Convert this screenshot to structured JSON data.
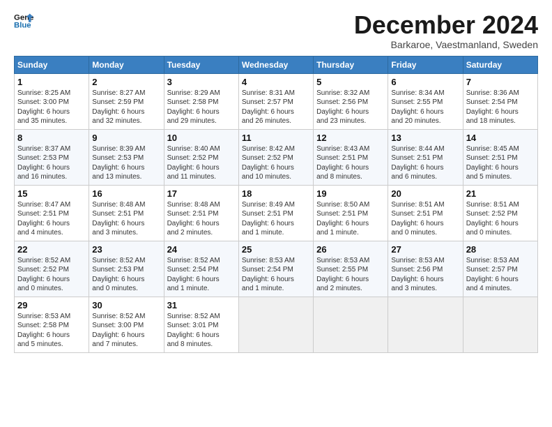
{
  "header": {
    "logo_line1": "General",
    "logo_line2": "Blue",
    "title": "December 2024",
    "subtitle": "Barkaroe, Vaestmanland, Sweden"
  },
  "weekdays": [
    "Sunday",
    "Monday",
    "Tuesday",
    "Wednesday",
    "Thursday",
    "Friday",
    "Saturday"
  ],
  "weeks": [
    [
      {
        "day": "1",
        "info": "Sunrise: 8:25 AM\nSunset: 3:00 PM\nDaylight: 6 hours\nand 35 minutes."
      },
      {
        "day": "2",
        "info": "Sunrise: 8:27 AM\nSunset: 2:59 PM\nDaylight: 6 hours\nand 32 minutes."
      },
      {
        "day": "3",
        "info": "Sunrise: 8:29 AM\nSunset: 2:58 PM\nDaylight: 6 hours\nand 29 minutes."
      },
      {
        "day": "4",
        "info": "Sunrise: 8:31 AM\nSunset: 2:57 PM\nDaylight: 6 hours\nand 26 minutes."
      },
      {
        "day": "5",
        "info": "Sunrise: 8:32 AM\nSunset: 2:56 PM\nDaylight: 6 hours\nand 23 minutes."
      },
      {
        "day": "6",
        "info": "Sunrise: 8:34 AM\nSunset: 2:55 PM\nDaylight: 6 hours\nand 20 minutes."
      },
      {
        "day": "7",
        "info": "Sunrise: 8:36 AM\nSunset: 2:54 PM\nDaylight: 6 hours\nand 18 minutes."
      }
    ],
    [
      {
        "day": "8",
        "info": "Sunrise: 8:37 AM\nSunset: 2:53 PM\nDaylight: 6 hours\nand 16 minutes."
      },
      {
        "day": "9",
        "info": "Sunrise: 8:39 AM\nSunset: 2:53 PM\nDaylight: 6 hours\nand 13 minutes."
      },
      {
        "day": "10",
        "info": "Sunrise: 8:40 AM\nSunset: 2:52 PM\nDaylight: 6 hours\nand 11 minutes."
      },
      {
        "day": "11",
        "info": "Sunrise: 8:42 AM\nSunset: 2:52 PM\nDaylight: 6 hours\nand 10 minutes."
      },
      {
        "day": "12",
        "info": "Sunrise: 8:43 AM\nSunset: 2:51 PM\nDaylight: 6 hours\nand 8 minutes."
      },
      {
        "day": "13",
        "info": "Sunrise: 8:44 AM\nSunset: 2:51 PM\nDaylight: 6 hours\nand 6 minutes."
      },
      {
        "day": "14",
        "info": "Sunrise: 8:45 AM\nSunset: 2:51 PM\nDaylight: 6 hours\nand 5 minutes."
      }
    ],
    [
      {
        "day": "15",
        "info": "Sunrise: 8:47 AM\nSunset: 2:51 PM\nDaylight: 6 hours\nand 4 minutes."
      },
      {
        "day": "16",
        "info": "Sunrise: 8:48 AM\nSunset: 2:51 PM\nDaylight: 6 hours\nand 3 minutes."
      },
      {
        "day": "17",
        "info": "Sunrise: 8:48 AM\nSunset: 2:51 PM\nDaylight: 6 hours\nand 2 minutes."
      },
      {
        "day": "18",
        "info": "Sunrise: 8:49 AM\nSunset: 2:51 PM\nDaylight: 6 hours\nand 1 minute."
      },
      {
        "day": "19",
        "info": "Sunrise: 8:50 AM\nSunset: 2:51 PM\nDaylight: 6 hours\nand 1 minute."
      },
      {
        "day": "20",
        "info": "Sunrise: 8:51 AM\nSunset: 2:51 PM\nDaylight: 6 hours\nand 0 minutes."
      },
      {
        "day": "21",
        "info": "Sunrise: 8:51 AM\nSunset: 2:52 PM\nDaylight: 6 hours\nand 0 minutes."
      }
    ],
    [
      {
        "day": "22",
        "info": "Sunrise: 8:52 AM\nSunset: 2:52 PM\nDaylight: 6 hours\nand 0 minutes."
      },
      {
        "day": "23",
        "info": "Sunrise: 8:52 AM\nSunset: 2:53 PM\nDaylight: 6 hours\nand 0 minutes."
      },
      {
        "day": "24",
        "info": "Sunrise: 8:52 AM\nSunset: 2:54 PM\nDaylight: 6 hours\nand 1 minute."
      },
      {
        "day": "25",
        "info": "Sunrise: 8:53 AM\nSunset: 2:54 PM\nDaylight: 6 hours\nand 1 minute."
      },
      {
        "day": "26",
        "info": "Sunrise: 8:53 AM\nSunset: 2:55 PM\nDaylight: 6 hours\nand 2 minutes."
      },
      {
        "day": "27",
        "info": "Sunrise: 8:53 AM\nSunset: 2:56 PM\nDaylight: 6 hours\nand 3 minutes."
      },
      {
        "day": "28",
        "info": "Sunrise: 8:53 AM\nSunset: 2:57 PM\nDaylight: 6 hours\nand 4 minutes."
      }
    ],
    [
      {
        "day": "29",
        "info": "Sunrise: 8:53 AM\nSunset: 2:58 PM\nDaylight: 6 hours\nand 5 minutes."
      },
      {
        "day": "30",
        "info": "Sunrise: 8:52 AM\nSunset: 3:00 PM\nDaylight: 6 hours\nand 7 minutes."
      },
      {
        "day": "31",
        "info": "Sunrise: 8:52 AM\nSunset: 3:01 PM\nDaylight: 6 hours\nand 8 minutes."
      },
      {
        "day": "",
        "info": ""
      },
      {
        "day": "",
        "info": ""
      },
      {
        "day": "",
        "info": ""
      },
      {
        "day": "",
        "info": ""
      }
    ]
  ]
}
